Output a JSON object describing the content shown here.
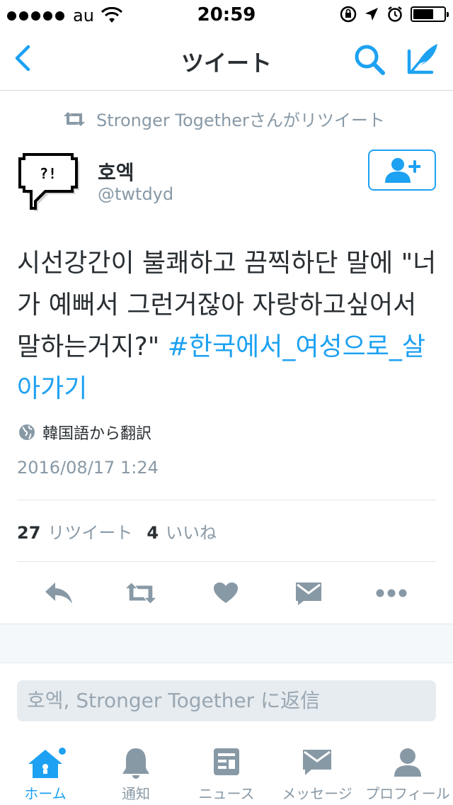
{
  "status_bar": {
    "carrier": "au",
    "time": "20:59"
  },
  "nav": {
    "title": "ツイート",
    "icons": [
      "back-chevron-icon",
      "search-icon",
      "compose-icon"
    ]
  },
  "retweet_context": {
    "text": "Stronger Togetherさんがリツイート"
  },
  "tweet": {
    "author_name": "호엑",
    "author_handle": "@twtdyd",
    "text": "시선강간이 불쾌하고 끔찍하단 말에 \"너가 예뻐서 그런거잖아 자랑하고싶어서 말하는거지?\" ",
    "hashtag": "#한국에서_여성으로_살아가기",
    "translate_label": "韓国語から翻訳",
    "timestamp": "2016/08/17 1:24",
    "retweet_count": "27",
    "retweet_label": "リツイート",
    "like_count": "4",
    "like_label": "いいね"
  },
  "reply": {
    "placeholder": "호엑, Stronger Together に返信"
  },
  "tabbar": {
    "tabs": [
      {
        "label": "ホーム",
        "icon": "home-icon",
        "active": true
      },
      {
        "label": "通知",
        "icon": "bell-icon",
        "active": false
      },
      {
        "label": "ニュース",
        "icon": "news-icon",
        "active": false
      },
      {
        "label": "メッセージ",
        "icon": "envelope-icon",
        "active": false
      },
      {
        "label": "プロフィール",
        "icon": "profile-icon",
        "active": false
      }
    ]
  },
  "colors": {
    "accent": "#1da1f2",
    "icon_gray": "#8899a6",
    "text": "#292f33"
  }
}
